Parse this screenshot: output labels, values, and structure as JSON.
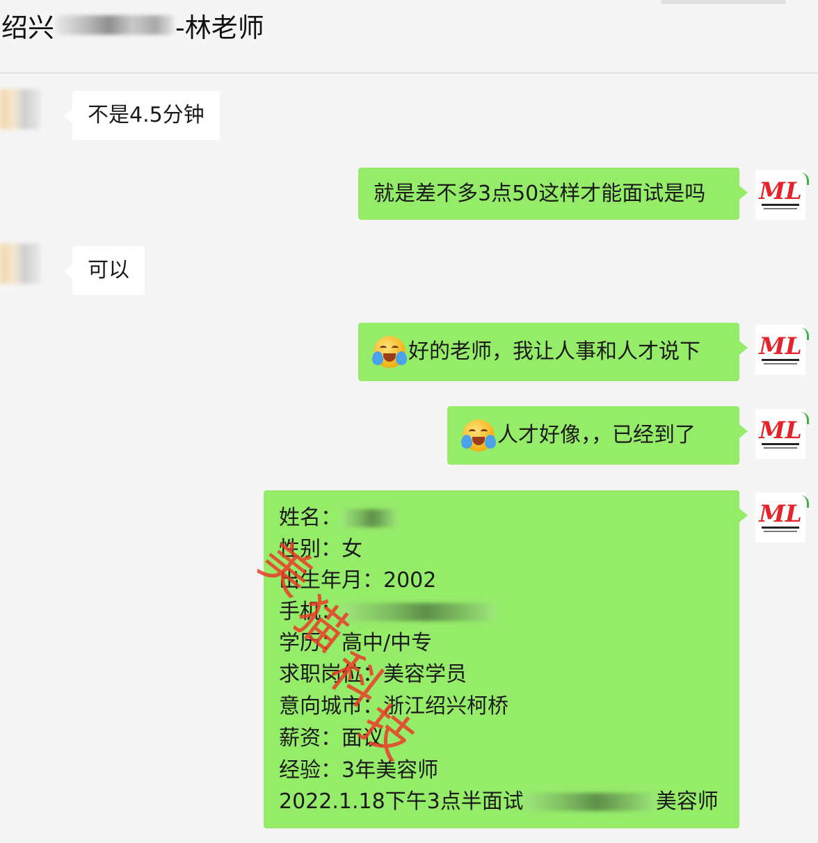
{
  "chat": {
    "title_prefix": "绍兴",
    "title_suffix": "-林老师"
  },
  "messages": [
    {
      "side": "left",
      "text": "不是4.5分钟"
    },
    {
      "side": "right",
      "text": "就是差不多3点50这样才能面试是吗"
    },
    {
      "side": "left",
      "text": "可以"
    },
    {
      "side": "right",
      "emoji": "crying-laughing-emoji",
      "text": "好的老师，我让人事和人才说下"
    },
    {
      "side": "right",
      "emoji": "crying-laughing-emoji",
      "text": "人才好像，，已经到了"
    }
  ],
  "resume": {
    "name_label": "姓名：",
    "gender": "性别：女",
    "birth": "出生年月：2002",
    "phone_label": "手机：",
    "education": "学历：高中/中专",
    "position": "求职岗位：美容学员",
    "city": "意向城市：浙江绍兴柯桥",
    "salary": "薪资：面议",
    "experience": "经验：3年美容师",
    "interview_prefix": "2022.1.18下午3点半面试",
    "interview_suffix": "美容师"
  },
  "watermark": {
    "chars": [
      "美",
      "猫",
      "科",
      "技"
    ],
    "color": "#eb3c28"
  },
  "avatar": {
    "brand_color": "#e5232a",
    "accent_color": "#3cb043"
  },
  "colors": {
    "outgoing_bubble": "#95ec69",
    "incoming_bubble": "#ffffff",
    "background": "#f5f5f5"
  }
}
